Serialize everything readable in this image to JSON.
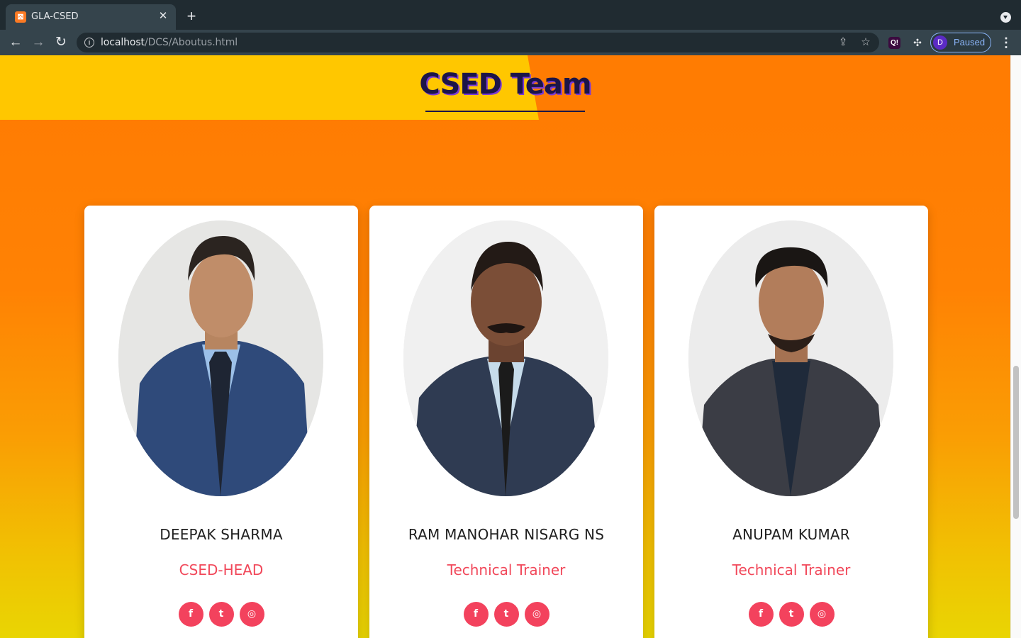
{
  "browser": {
    "tab": {
      "title": "GLA-CSED",
      "favicon": "xampp-icon"
    },
    "url": {
      "host": "localhost",
      "path": "/DCS/Aboutus.html"
    },
    "profile": {
      "initial": "D",
      "label": "Paused"
    }
  },
  "page": {
    "heading": "CSED Team",
    "colors": {
      "accent": "#f3425d",
      "heading": "#1c1548",
      "band_yellow": "#ffc700",
      "band_orange": "#ff7c02"
    }
  },
  "team": [
    {
      "name": "DEEPAK SHARMA",
      "role": "CSED-HEAD",
      "socials": [
        "facebook-icon",
        "twitter-icon",
        "instagram-icon"
      ]
    },
    {
      "name": "RAM MANOHAR NISARG NS",
      "role": "Technical Trainer",
      "socials": [
        "facebook-icon",
        "twitter-icon",
        "instagram-icon"
      ]
    },
    {
      "name": "ANUPAM KUMAR",
      "role": "Technical Trainer",
      "socials": [
        "facebook-icon",
        "twitter-icon",
        "instagram-icon"
      ]
    }
  ]
}
